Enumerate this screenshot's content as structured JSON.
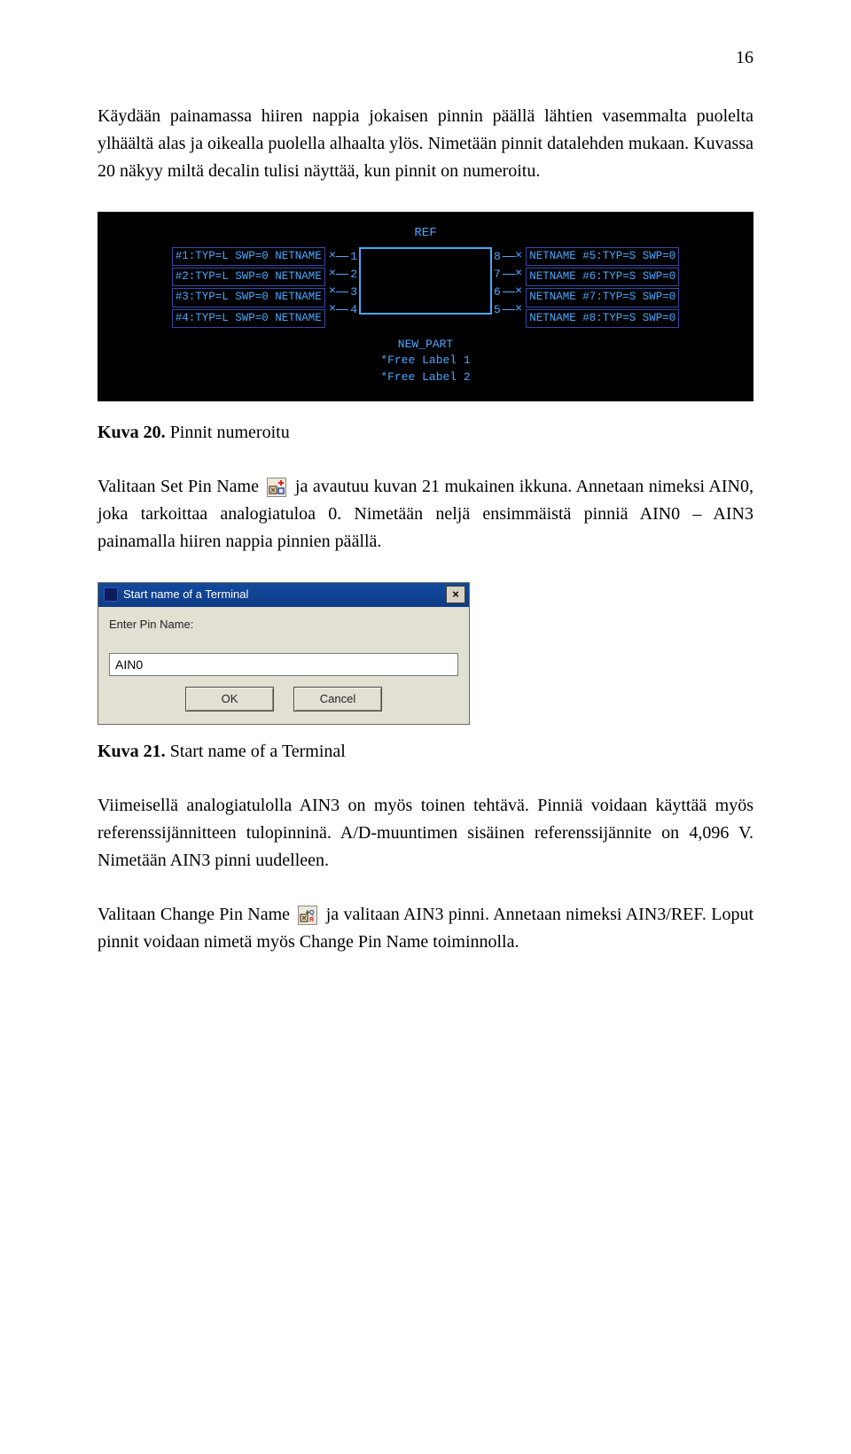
{
  "page_number": "16",
  "para1": "Käydään painamassa hiiren nappia jokaisen pinnin päällä lähtien vasemmalta puolelta ylhäältä alas ja oikealla puolella alhaalta ylös. Nimetään pinnit datalehden mukaan. Kuvassa 20 näkyy miltä decalin tulisi näyttää, kun pinnit on numeroitu.",
  "schematic": {
    "ref": "REF",
    "left_labels": [
      "#1:TYP=L SWP=0 NETNAME",
      "#2:TYP=L SWP=0 NETNAME",
      "#3:TYP=L SWP=0 NETNAME",
      "#4:TYP=L SWP=0 NETNAME"
    ],
    "left_pins": [
      "1",
      "2",
      "3",
      "4"
    ],
    "right_labels": [
      "NETNAME #5:TYP=S SWP=0",
      "NETNAME #6:TYP=S SWP=0",
      "NETNAME #7:TYP=S SWP=0",
      "NETNAME #8:TYP=S SWP=0"
    ],
    "right_pins": [
      "8",
      "7",
      "6",
      "5"
    ],
    "bottom": [
      "NEW_PART",
      "*Free Label 1",
      "*Free Label 2"
    ]
  },
  "caption20_bold": "Kuva 20.",
  "caption20_rest": " Pinnit numeroitu",
  "para2a": "Valitaan Set Pin Name ",
  "para2b": " ja avautuu kuvan 21 mukainen ikkuna. Annetaan nimeksi AIN0, joka tarkoittaa analogiatuloa 0. Nimetään neljä ensimmäistä pinniä AIN0 – AIN3 painamalla hiiren nappia pinnien päällä.",
  "dialog": {
    "title": "Start name of a Terminal",
    "prompt": "Enter Pin Name:",
    "value": "AIN0",
    "ok": "OK",
    "cancel": "Cancel"
  },
  "caption21_bold": "Kuva 21.",
  "caption21_rest": " Start name of a Terminal",
  "para3": "Viimeisellä analogiatulolla AIN3 on myös toinen tehtävä. Pinniä voidaan käyttää myös referenssijännitteen tulopinninä. A/D-muuntimen sisäinen referenssijännite on 4,096 V. Nimetään AIN3 pinni uudelleen.",
  "para4a": "Valitaan Change Pin Name ",
  "para4b": " ja valitaan AIN3 pinni. Annetaan nimeksi AIN3/REF. Loput pinnit voidaan nimetä myös Change Pin Name toiminnolla."
}
